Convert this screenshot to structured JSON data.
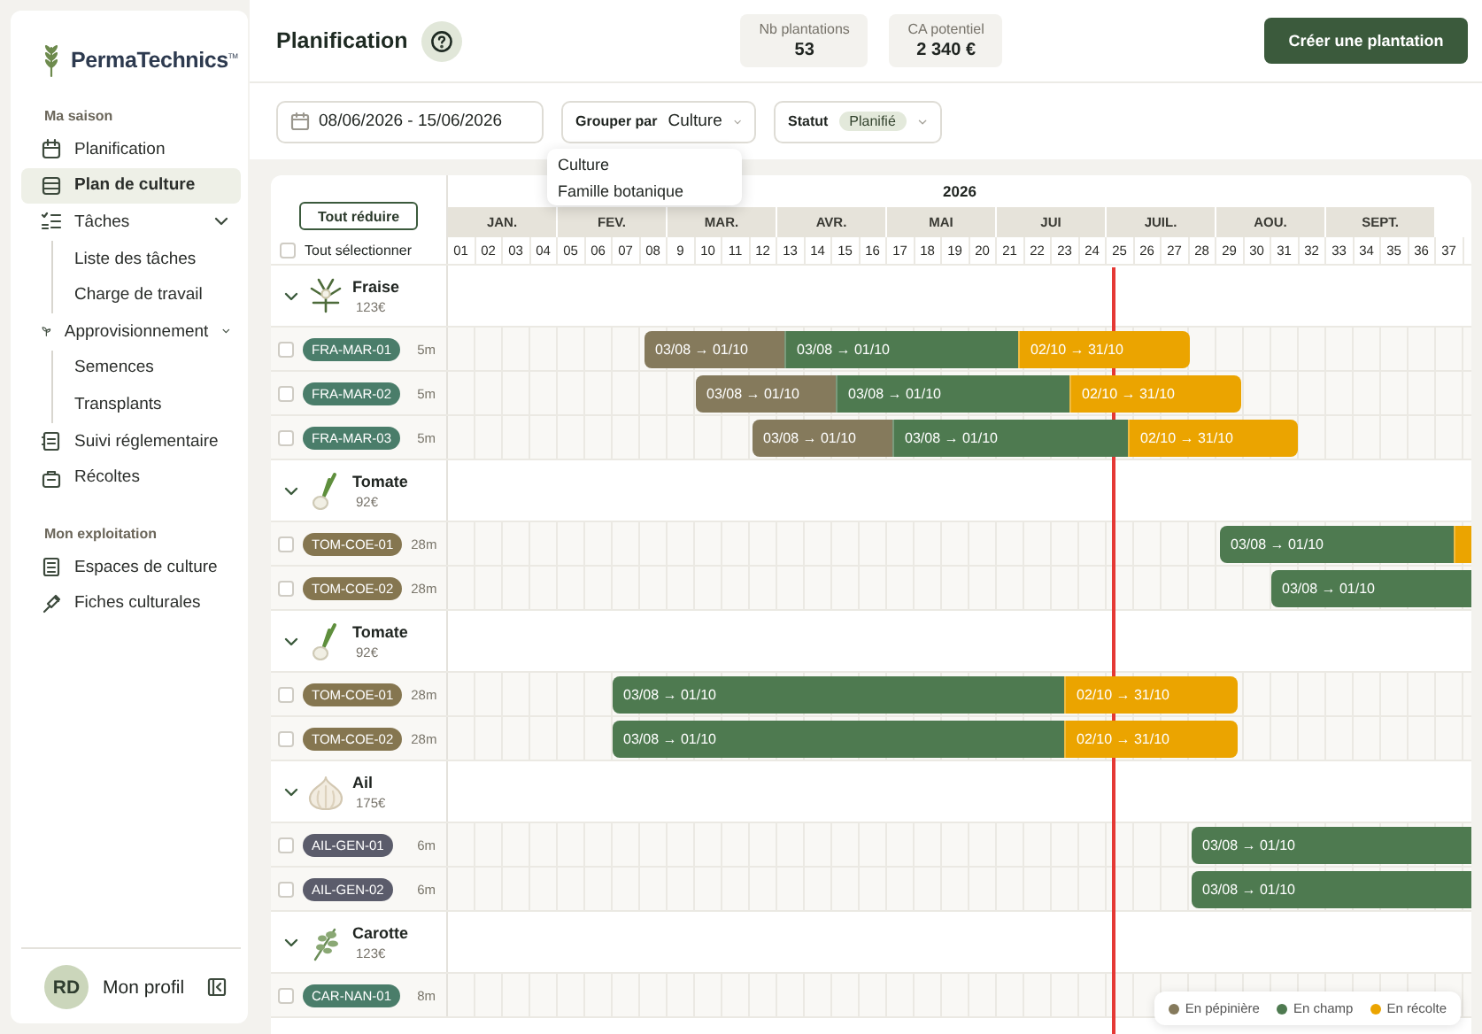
{
  "sidebar": {
    "logo": "PermaTechnics$^{TM}$",
    "sections": [
      {
        "title": "Ma saison",
        "items": [
          {
            "label": "Planification",
            "selected": false
          },
          {
            "label": "Plan de culture",
            "selected": true
          },
          {
            "label": "Tâches",
            "selected": false,
            "expanded": true,
            "children": [
              {
                "label": "Liste des tâches",
                "selected": false
              },
              {
                "label": "Charge de travail",
                "selected": false
              }
            ]
          },
          {
            "label": "Approvisionnement",
            "selected": false,
            "expanded": true,
            "children": [
              {
                "label": "Semences",
                "selected": false
              },
              {
                "label": "Transplants",
                "selected": false
              }
            ]
          },
          {
            "label": "Suivi réglementaire",
            "selected": false
          },
          {
            "label": "Récoltes",
            "selected": false
          }
        ]
      },
      {
        "title": "Mon exploitation",
        "items": [
          {
            "label": "Espaces de culture",
            "selected": false
          },
          {
            "label": "Fiches culturales",
            "selected": false
          }
        ]
      }
    ],
    "profile": {
      "initials": "RD",
      "name": "Mon profil"
    }
  },
  "header": {
    "title": "Planification",
    "stats": [
      {
        "label": "Nb plantations",
        "value": "53"
      },
      {
        "label": "CA potentiel",
        "value": "2 340 €"
      }
    ],
    "primary_button": "Créer une plantation"
  },
  "filters": {
    "date_range": "08/06/2026 - 15/06/2026",
    "group_by": {
      "label": "Grouper par",
      "value": "Culture",
      "open": true,
      "options": [
        {
          "label": "Culture"
        },
        {
          "label": "Famille botanique"
        }
      ]
    },
    "status": {
      "label": "Statut",
      "chip": "Planifié"
    }
  },
  "gantt": {
    "collapse_button": "Tout réduire",
    "select_all": {
      "label": "Tout sélectionner",
      "checked": false
    },
    "year": "2026",
    "months": [
      "JAN.",
      "FEV.",
      "MAR.",
      "AVR.",
      "MAI",
      "JUI",
      "JUIL.",
      "AOU.",
      "SEPT."
    ],
    "weeks": [
      "01",
      "02",
      "03",
      "04",
      "05",
      "06",
      "07",
      "08",
      "9",
      "10",
      "11",
      "12",
      "13",
      "14",
      "15",
      "16",
      "17",
      "18",
      "19",
      "20",
      "21",
      "22",
      "23",
      "24",
      "25",
      "26",
      "27",
      "28",
      "29",
      "30",
      "31",
      "32",
      "33",
      "34",
      "35",
      "36",
      "37"
    ],
    "groups": [
      {
        "name": "Fraise",
        "price": "123€",
        "expanded": true,
        "rows": [
          {
            "code": "FRA-MAR-01",
            "color": "#4a7d6a",
            "length": "5m",
            "checked": false,
            "segments": [
              {
                "kind": "nursery",
                "label": "03/08 → 01/10"
              },
              {
                "kind": "field",
                "label": "03/08 → 01/10"
              },
              {
                "kind": "harvest",
                "label": "02/10 → 31/10"
              }
            ]
          },
          {
            "code": "FRA-MAR-02",
            "color": "#4a7d6a",
            "length": "5m",
            "checked": false,
            "segments": [
              {
                "kind": "nursery",
                "label": "03/08 → 01/10"
              },
              {
                "kind": "field",
                "label": "03/08 → 01/10"
              },
              {
                "kind": "harvest",
                "label": "02/10 → 31/10"
              }
            ]
          },
          {
            "code": "FRA-MAR-03",
            "color": "#4a7d6a",
            "length": "5m",
            "checked": false,
            "segments": [
              {
                "kind": "nursery",
                "label": "03/08 → 01/10"
              },
              {
                "kind": "field",
                "label": "03/08 → 01/10"
              },
              {
                "kind": "harvest",
                "label": "02/10 → 31/10"
              }
            ]
          }
        ]
      },
      {
        "name": "Tomate",
        "price": "92€",
        "expanded": true,
        "rows": [
          {
            "code": "TOM-COE-01",
            "color": "#857650",
            "length": "28m",
            "checked": false,
            "segments": [
              {
                "kind": "field",
                "label": "03/08 → 01/10"
              },
              {
                "kind": "harvest"
              }
            ]
          },
          {
            "code": "TOM-COE-02",
            "color": "#857650",
            "length": "28m",
            "checked": false,
            "segments": [
              {
                "kind": "field",
                "label": "03/08 → 01/10"
              }
            ]
          }
        ]
      },
      {
        "name": "Tomate",
        "price": "92€",
        "expanded": true,
        "rows": [
          {
            "code": "TOM-COE-01",
            "color": "#857650",
            "length": "28m",
            "checked": false,
            "segments": [
              {
                "kind": "field",
                "label": "03/08 → 01/10"
              },
              {
                "kind": "harvest",
                "label": "02/10 → 31/10"
              }
            ]
          },
          {
            "code": "TOM-COE-02",
            "color": "#857650",
            "length": "28m",
            "checked": false,
            "segments": [
              {
                "kind": "field",
                "label": "03/08 → 01/10"
              },
              {
                "kind": "harvest",
                "label": "02/10 → 31/10"
              }
            ]
          }
        ]
      },
      {
        "name": "Ail",
        "price": "175€",
        "expanded": true,
        "rows": [
          {
            "code": "AIL-GEN-01",
            "color": "#5b5c6b",
            "length": "6m",
            "checked": false,
            "segments": [
              {
                "kind": "field",
                "label": "03/08 → 01/10"
              }
            ]
          },
          {
            "code": "AIL-GEN-02",
            "color": "#5b5c6b",
            "length": "6m",
            "checked": false,
            "segments": [
              {
                "kind": "field",
                "label": "03/08 → 01/10"
              }
            ]
          }
        ]
      },
      {
        "name": "Carotte",
        "price": "123€",
        "expanded": true,
        "rows": [
          {
            "code": "CAR-NAN-01",
            "color": "#4a7d6a",
            "length": "8m",
            "checked": false,
            "segments": []
          }
        ]
      }
    ],
    "legend": [
      {
        "label": "En pépinière",
        "color": "#857a5c"
      },
      {
        "label": "En champ",
        "color": "#4e7a50"
      },
      {
        "label": "En récolte",
        "color": "#eba400"
      }
    ]
  }
}
